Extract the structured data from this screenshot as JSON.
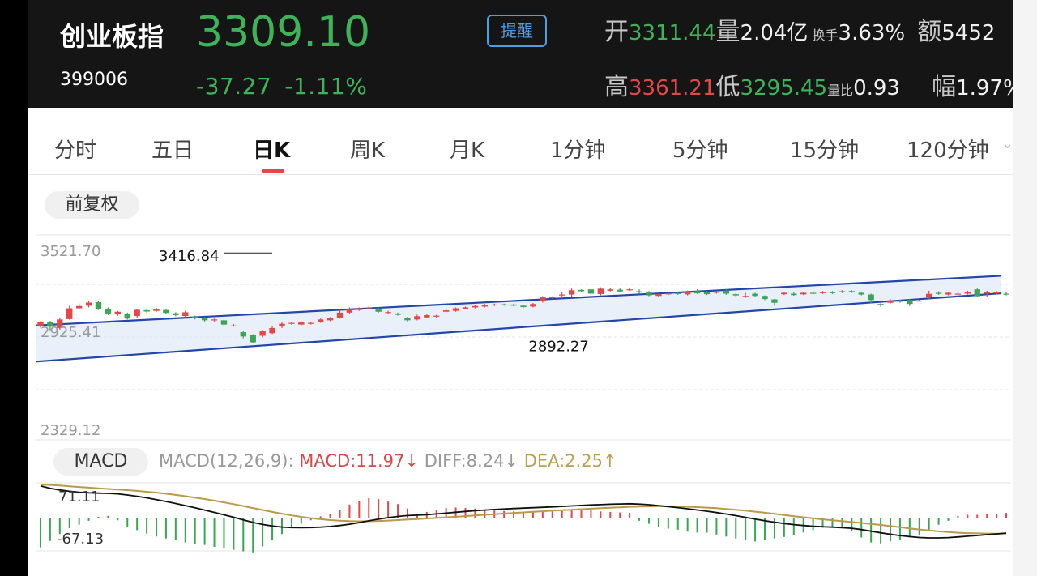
{
  "header": {
    "name": "创业板指",
    "code": "399006",
    "price": "3309.10",
    "change": "-37.27",
    "change_pct": "-1.11%",
    "alert_label": "提醒",
    "open_label": "开",
    "open": "3311.44",
    "volume_label": "量",
    "volume": "2.04亿",
    "turnover_label": "换手",
    "turnover": "3.63%",
    "amount_label": "额",
    "amount": "5452",
    "high_label": "高",
    "high": "3361.21",
    "low_label": "低",
    "low": "3295.45",
    "vol_ratio_label": "量比",
    "vol_ratio": "0.93",
    "amplitude_label": "幅",
    "amplitude": "1.97%"
  },
  "tabs": [
    "分时",
    "五日",
    "日K",
    "周K",
    "月K",
    "1分钟",
    "5分钟",
    "15分钟",
    "120分钟"
  ],
  "active_tab": "日K",
  "adjust_label": "前复权",
  "macd": {
    "button": "MACD",
    "params": "MACD(12,26,9):",
    "macd": "MACD:11.97↓",
    "diff": "DIFF:8.24↓",
    "dea": "DEA:2.25↑"
  },
  "colors": {
    "up": "#e34848",
    "down": "#3aa655",
    "channel": "#2347a8",
    "dif": "#111111",
    "dea": "#b89a4a"
  },
  "chart_data": {
    "type": "candlestick",
    "price_axis": {
      "top_label": "3521.70",
      "mid_label": "2925.41",
      "bottom_label": "2329.12",
      "ylim": [
        2329.12,
        3521.7
      ]
    },
    "annotations": [
      {
        "text": "3416.84",
        "value": 3416.84,
        "index": 24
      },
      {
        "text": "2892.27",
        "value": 2892.27,
        "index": 45
      }
    ],
    "candles": [
      [
        2993,
        3014,
        2983,
        3020
      ],
      [
        3015,
        2988,
        3022,
        2968
      ],
      [
        2980,
        3030,
        2970,
        3039
      ],
      [
        3032,
        3095,
        3029,
        3110
      ],
      [
        3095,
        3108,
        3090,
        3123
      ],
      [
        3110,
        3128,
        3100,
        3138
      ],
      [
        3131,
        3092,
        3140,
        3085
      ],
      [
        3092,
        3065,
        3100,
        3055
      ],
      [
        3064,
        3075,
        3051,
        3080
      ],
      [
        3065,
        3035,
        3070,
        3030
      ],
      [
        3050,
        3086,
        3040,
        3091
      ],
      [
        3084,
        3076,
        3094,
        3070
      ],
      [
        3080,
        3090,
        3073,
        3098
      ],
      [
        3085,
        3068,
        3092,
        3061
      ],
      [
        3066,
        3055,
        3072,
        3048
      ],
      [
        3050,
        3072,
        3045,
        3082
      ],
      [
        3045,
        3040,
        3052,
        3030
      ],
      [
        3040,
        3025,
        3045,
        3018
      ],
      [
        3025,
        3030,
        3018,
        3035
      ],
      [
        3025,
        3000,
        3030,
        2995
      ],
      [
        2995,
        2995,
        3003,
        2988
      ],
      [
        2956,
        2931,
        2961,
        2920
      ],
      [
        2941,
        2897,
        2944,
        2892
      ],
      [
        2935,
        2964,
        2925,
        2969
      ],
      [
        2950,
        2980,
        2945,
        2991
      ],
      [
        2990,
        3005,
        2980,
        3012
      ],
      [
        3005,
        3010,
        2999,
        3016
      ],
      [
        3000,
        3015,
        2995,
        3020
      ],
      [
        3005,
        3010,
        3000,
        3015
      ],
      [
        3015,
        3030,
        3010,
        3035
      ],
      [
        3025,
        3039,
        3020,
        3044
      ],
      [
        3040,
        3070,
        3035,
        3080
      ],
      [
        3070,
        3090,
        3065,
        3100
      ],
      [
        3085,
        3095,
        3080,
        3100
      ],
      [
        3095,
        3100,
        3090,
        3105
      ],
      [
        3095,
        3075,
        3100,
        3070
      ],
      [
        3070,
        3073,
        3065,
        3080
      ],
      [
        3065,
        3057,
        3070,
        3052
      ],
      [
        3040,
        3025,
        3045,
        3018
      ],
      [
        3030,
        3049,
        3025,
        3058
      ],
      [
        3042,
        3055,
        3038,
        3062
      ],
      [
        3047,
        3052,
        3040,
        3057
      ],
      [
        3075,
        3083,
        3070,
        3090
      ],
      [
        3080,
        3095,
        3075,
        3100
      ],
      [
        3092,
        3100,
        3088,
        3105
      ],
      [
        3100,
        3108,
        3095,
        3112
      ],
      [
        3105,
        3115,
        3100,
        3120
      ],
      [
        3112,
        3117,
        3108,
        3122
      ],
      [
        3118,
        3113,
        3122,
        3110
      ],
      [
        3117,
        3110,
        3122,
        3106
      ],
      [
        3110,
        3102,
        3115,
        3098
      ],
      [
        3105,
        3120,
        3100,
        3126
      ],
      [
        3135,
        3160,
        3128,
        3166
      ],
      [
        3155,
        3160,
        3150,
        3165
      ],
      [
        3170,
        3175,
        3164,
        3190
      ],
      [
        3175,
        3200,
        3160,
        3210
      ],
      [
        3202,
        3194,
        3205,
        3189
      ],
      [
        3205,
        3180,
        3210,
        3172
      ],
      [
        3178,
        3209,
        3170,
        3217
      ],
      [
        3197,
        3205,
        3193,
        3211
      ],
      [
        3203,
        3193,
        3215,
        3188
      ],
      [
        3201,
        3205,
        3196,
        3215
      ],
      [
        3194,
        3189,
        3205,
        3180
      ],
      [
        3190,
        3170,
        3195,
        3165
      ],
      [
        3167,
        3177,
        3162,
        3182
      ],
      [
        3176,
        3182,
        3170,
        3188
      ],
      [
        3184,
        3178,
        3189,
        3173
      ],
      [
        3176,
        3193,
        3170,
        3198
      ],
      [
        3195,
        3182,
        3205,
        3178
      ],
      [
        3187,
        3177,
        3195,
        3172
      ],
      [
        3185,
        3191,
        3180,
        3195
      ],
      [
        3198,
        3180,
        3205,
        3173
      ],
      [
        3177,
        3170,
        3182,
        3165
      ],
      [
        3160,
        3167,
        3155,
        3185
      ],
      [
        3180,
        3167,
        3185,
        3162
      ],
      [
        3167,
        3149,
        3170,
        3142
      ],
      [
        3147,
        3127,
        3150,
        3110
      ],
      [
        3177,
        3185,
        3172,
        3190
      ],
      [
        3180,
        3172,
        3190,
        3168
      ],
      [
        3176,
        3185,
        3172,
        3190
      ],
      [
        3185,
        3180,
        3190,
        3175
      ],
      [
        3183,
        3189,
        3178,
        3195
      ],
      [
        3190,
        3183,
        3195,
        3178
      ],
      [
        3189,
        3194,
        3184,
        3200
      ],
      [
        3195,
        3190,
        3200,
        3185
      ],
      [
        3185,
        3175,
        3190,
        3170
      ],
      [
        3175,
        3143,
        3180,
        3125
      ],
      [
        3120,
        3112,
        3125,
        3104
      ],
      [
        3127,
        3141,
        3122,
        3149
      ],
      [
        3140,
        3133,
        3145,
        3128
      ],
      [
        3144,
        3120,
        3148,
        3108
      ],
      [
        3140,
        3140,
        3135,
        3145
      ],
      [
        3160,
        3179,
        3150,
        3197
      ],
      [
        3185,
        3179,
        3194,
        3174
      ],
      [
        3175,
        3185,
        3170,
        3190
      ],
      [
        3180,
        3180,
        3175,
        3190
      ],
      [
        3180,
        3192,
        3175,
        3197
      ],
      [
        3205,
        3165,
        3210,
        3160
      ],
      [
        3180,
        3191,
        3160,
        3197
      ],
      [
        3185,
        3188,
        3175,
        3195
      ],
      [
        3180,
        3178,
        3190,
        3170
      ]
    ],
    "channel": {
      "upper": [
        [
          0,
          2995
        ],
        [
          100,
          3284
        ]
      ],
      "lower": [
        [
          0,
          2785
        ],
        [
          100,
          3182
        ]
      ]
    },
    "macd_axis": {
      "top_label": "71.11",
      "bottom_label": "-67.13",
      "ylim": [
        -67.13,
        71.11
      ]
    },
    "macd_hist": [
      -60,
      -47,
      -33,
      -21,
      -14,
      -6,
      2,
      4,
      -5,
      -18,
      -25,
      -32,
      -38,
      -42,
      -45,
      -50,
      -53,
      -55,
      -59,
      -62,
      -65,
      -68,
      -70,
      -58,
      -46,
      -33,
      -20,
      -12,
      -5,
      3,
      8,
      16,
      27,
      34,
      40,
      38,
      33,
      28,
      19,
      8,
      12,
      16,
      20,
      21,
      20,
      19,
      17,
      15,
      14,
      13,
      12,
      11,
      12,
      13,
      14,
      15,
      15,
      15,
      13,
      12,
      11,
      10,
      -6,
      -12,
      -18,
      -22,
      -24,
      -28,
      -30,
      -30,
      -34,
      -38,
      -42,
      -46,
      -48,
      -44,
      -42,
      -39,
      -35,
      -30,
      -25,
      -20,
      -18,
      -20,
      -26,
      -40,
      -50,
      -52,
      -48,
      -44,
      -40,
      -34,
      -24,
      -14,
      -6,
      4,
      6,
      6,
      7,
      8,
      10
    ]
  }
}
